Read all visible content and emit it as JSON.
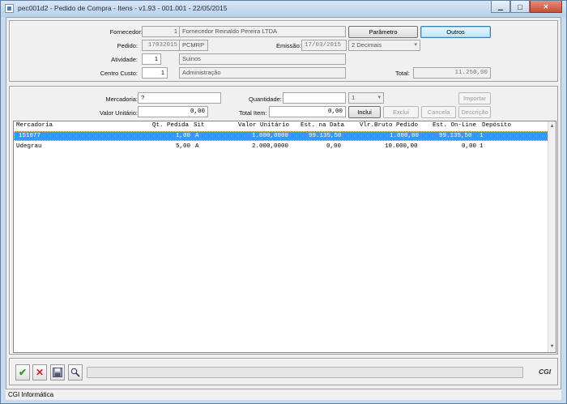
{
  "window": {
    "title": "pec001d2 - Pedido de Compra - Itens - v1.93 - 001.001 - 22/05/2015"
  },
  "header": {
    "fornecedor_label": "Fornecedor:",
    "fornecedor_code": "1",
    "fornecedor_name": "Fornecedor Reinaldo Pereira LTDA",
    "pedido_label": "Pedido:",
    "pedido_number": "17032015",
    "pedido_type": "PCMRP",
    "emissao_label": "Emissão:",
    "emissao_date": "17/03/2015",
    "decimals_select": "2 Decimais",
    "atividade_label": "Atividade:",
    "atividade_code": "1",
    "atividade_name": "Suinos",
    "centro_custo_label": "Centro Custo:",
    "centro_custo_code": "1",
    "centro_custo_name": "Administração",
    "total_label": "Total:",
    "total_value": "11.250,00",
    "parametro_button": "Parâmetro",
    "outros_button": "Outros"
  },
  "item_form": {
    "mercadoria_label": "Mercadoria:",
    "mercadoria_value": "?",
    "quantidade_label": "Quantidade:",
    "quantidade_value": "",
    "qty_select": "1",
    "importar_button": "Importar",
    "valor_unitario_label": "Valor Unitário:",
    "valor_unitario_value": "0,00",
    "total_item_label": "Total Item:",
    "total_item_value": "0,00",
    "inclui_button": "Inclui",
    "exclui_button": "Exclui",
    "cancela_button": "Cancela",
    "descricao_button": "Descrição"
  },
  "grid": {
    "columns": [
      "Mercadoria",
      "Qt. Pedida",
      "Sit",
      "Valor Unitário",
      "Est. na Data",
      "Vlr.Bruto Pedido",
      "Est. On-Line",
      "Depósito"
    ],
    "rows": [
      {
        "mercadoria": "151077",
        "qt_pedida": "1,00",
        "sit": "A",
        "valor_unitario": "1.000,0000",
        "est_data": "99.135,50",
        "vlr_bruto": "1.000,00",
        "est_online": "99.135,50",
        "deposito": "1",
        "selected": true
      },
      {
        "mercadoria": "Udegrau",
        "qt_pedida": "5,00",
        "sit": "A",
        "valor_unitario": "2.000,0000",
        "est_data": "0,00",
        "vlr_bruto": "10.000,00",
        "est_online": "0,00",
        "deposito": "1",
        "selected": false
      }
    ]
  },
  "toolbar": {
    "confirm_icon": "check-icon",
    "cancel_icon": "x-icon",
    "save_icon": "floppy-disk-icon",
    "search_icon": "magnifier-icon",
    "logo_text": "CGI"
  },
  "status_bar": {
    "text": "CGI Informática"
  },
  "colors": {
    "selection": "#3399ff",
    "window_frame": "#c9dcef",
    "confirm_green": "#2e9a2e",
    "cancel_red": "#d42020"
  }
}
